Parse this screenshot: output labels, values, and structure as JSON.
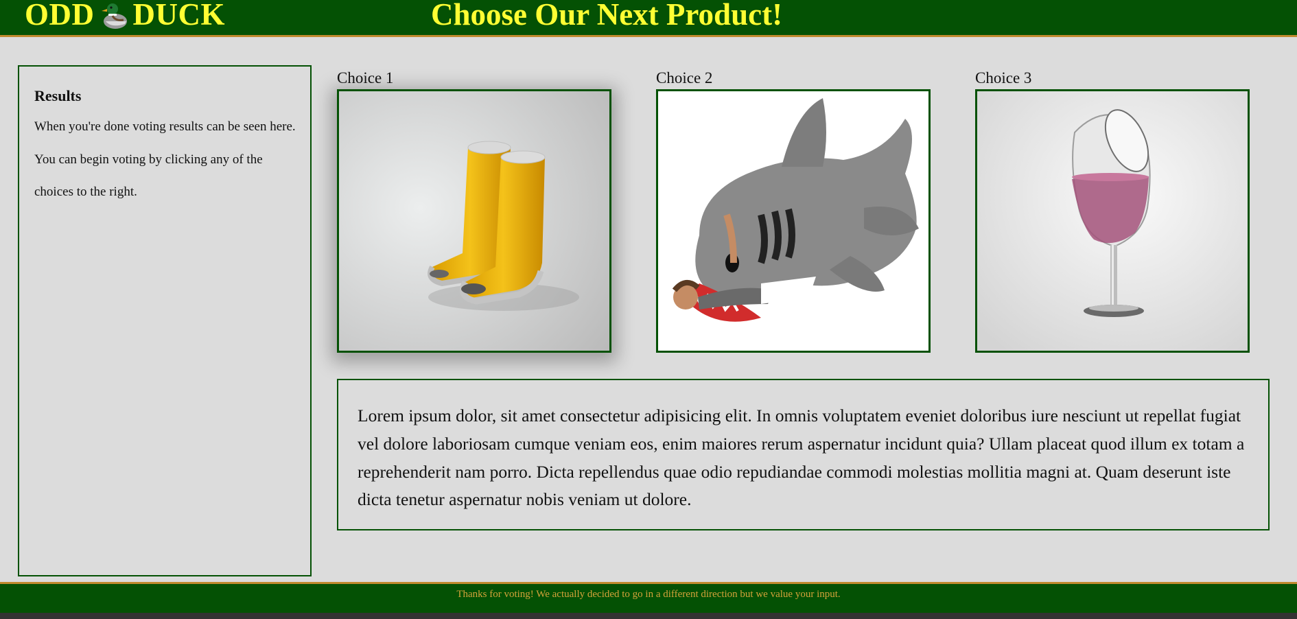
{
  "header": {
    "logo_left": "ODD",
    "logo_right": "DUCK",
    "logo_icon": "duck-icon",
    "title": "Choose Our Next Product!"
  },
  "results": {
    "heading": "Results",
    "text": "When you're done voting results can be seen here. You can begin voting by clicking any of the choices to the right."
  },
  "choices": [
    {
      "label": "Choice 1",
      "image": "yellow-boots-image"
    },
    {
      "label": "Choice 2",
      "image": "shark-sleeping-bag-image"
    },
    {
      "label": "Choice 3",
      "image": "wine-glass-image"
    }
  ],
  "description": "Lorem ipsum dolor, sit amet consectetur adipisicing elit. In omnis voluptatem eveniet doloribus iure nesciunt ut repellat fugiat vel dolore laboriosam cumque veniam eos, enim maiores rerum aspernatur incidunt quia? Ullam placeat quod illum ex totam a reprehenderit nam porro. Dicta repellendus quae odio repudiandae commodi molestias mollitia magni at. Quam deserunt iste dicta tenetur aspernatur nobis veniam ut dolore.",
  "footer": {
    "text": "Thanks for voting! We actually decided to go in a different direction but we value your input."
  },
  "colors": {
    "header_bg": "#045104",
    "header_text": "#ffff33",
    "accent_border": "#c08a2e",
    "page_bg": "#dcdcdc",
    "footer_text": "#d4a23a"
  }
}
